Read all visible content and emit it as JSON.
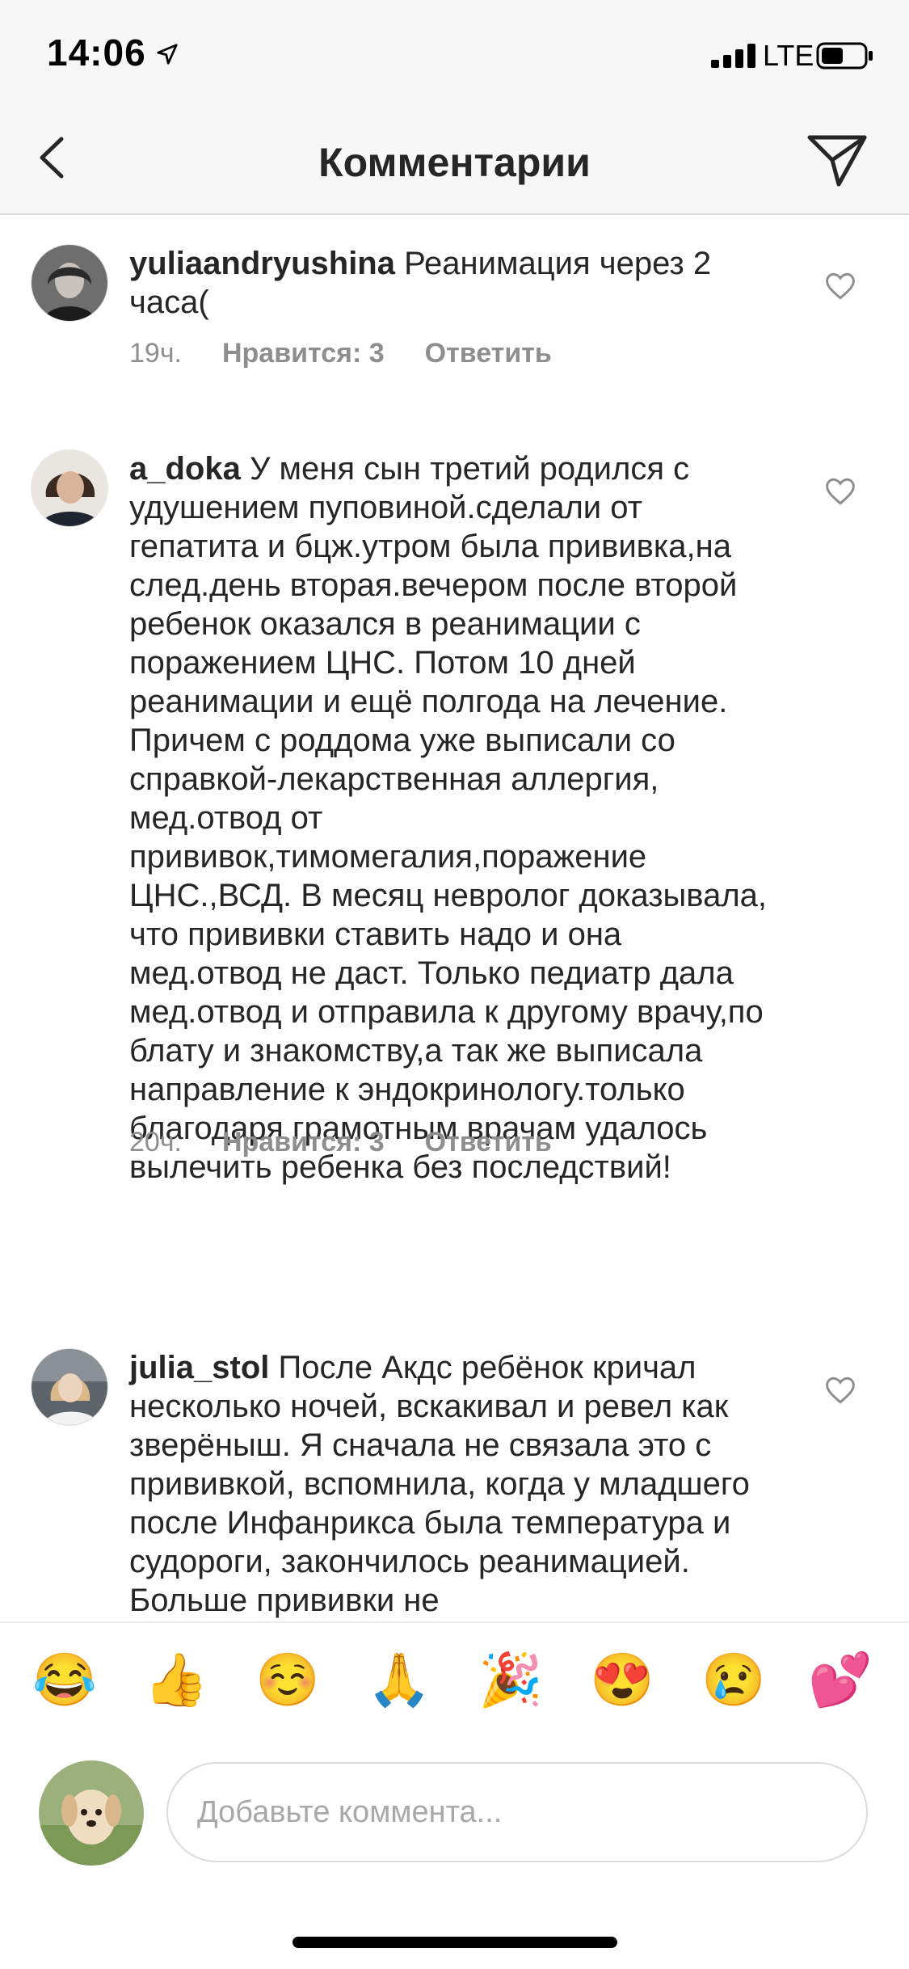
{
  "status_bar": {
    "time": "14:06",
    "network": "LTE"
  },
  "header": {
    "title": "Комментарии"
  },
  "comments": [
    {
      "username": "yuliaandryushina",
      "text": "Реанимация через 2 часа(",
      "time": "19ч.",
      "likes": "Нравится: 3",
      "reply": "Ответить"
    },
    {
      "username": "a_doka",
      "text": "У меня сын третий родился с удушением пуповиной.сделали от гепатита и бцж.утром была прививка,на след.день вторая.вечером после второй ребенок оказался в реанимации с поражением ЦНС. Потом 10 дней реанимации и ещё полгода на лечение. Причем с роддома уже выписали со справкой-лекарственная аллергия, мед.отвод от прививок,тимомегалия,поражение ЦНС.,ВСД. В месяц невролог доказывала, что прививки ставить надо и она мед.отвод не даст. Только педиатр дала мед.отвод и отправила к другому врачу,по блату и знакомству,а так же выписала направление к эндокринологу.только благодаря грамотным врачам удалось вылечить ребенка без последствий!",
      "time": "20ч.",
      "likes": "Нравится: 3",
      "reply": "Ответить"
    },
    {
      "username": "julia_stol",
      "text": "После Акдс ребёнок кричал несколько ночей, вскакивал и ревел как зверёныш. Я сначала не связала это с прививкой, вспомнила, когда у младшего после Инфанрикса была температура и судороги, закончилось реанимацией. Больше прививки не"
    }
  ],
  "emoji_bar": [
    "😂",
    "👍",
    "☺️",
    "🙏",
    "🎉",
    "😍",
    "😢",
    "💕"
  ],
  "composer": {
    "placeholder": "Добавьте коммента..."
  },
  "colors": {
    "text": "#262626",
    "secondary": "#8e8e8e",
    "divider": "#dbdbdb"
  }
}
